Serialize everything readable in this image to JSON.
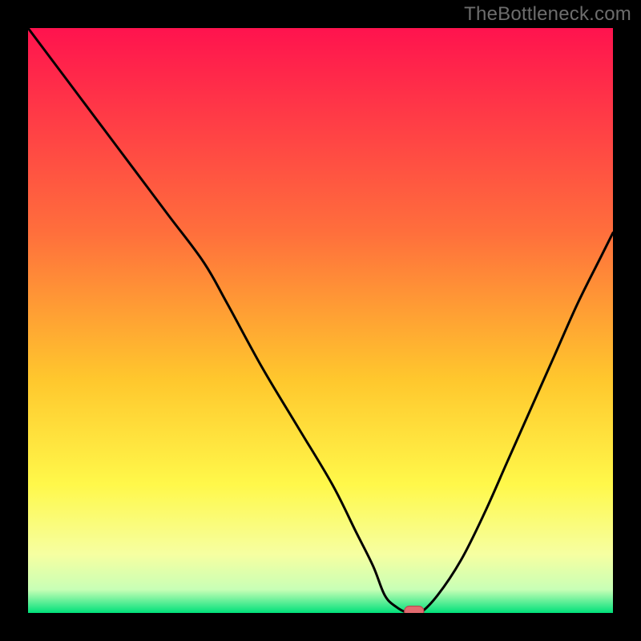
{
  "attribution": "TheBottleneck.com",
  "colors": {
    "top": "#ff134e",
    "mid1": "#ff6f3c",
    "mid2": "#ffc72d",
    "mid3": "#fff84a",
    "mid4": "#f6ffa1",
    "mid5": "#c8ffb6",
    "bottom": "#00e07a",
    "curve": "#000000",
    "marker_fill": "#e26a6f",
    "marker_stroke": "#b94a50"
  },
  "chart_data": {
    "type": "line",
    "title": "",
    "xlabel": "",
    "ylabel": "",
    "xlim": [
      0,
      100
    ],
    "ylim": [
      0,
      100
    ],
    "x": [
      0,
      6,
      12,
      18,
      24,
      30,
      34,
      40,
      46,
      52,
      56,
      59,
      61,
      63,
      65,
      67,
      70,
      74,
      78,
      82,
      86,
      90,
      94,
      98,
      100
    ],
    "y": [
      100,
      92,
      84,
      76,
      68,
      60,
      53,
      42,
      32,
      22,
      14,
      8,
      3,
      1,
      0,
      0,
      3,
      9,
      17,
      26,
      35,
      44,
      53,
      61,
      65
    ],
    "marker": {
      "x": 66,
      "y": 0
    },
    "annotations": []
  }
}
